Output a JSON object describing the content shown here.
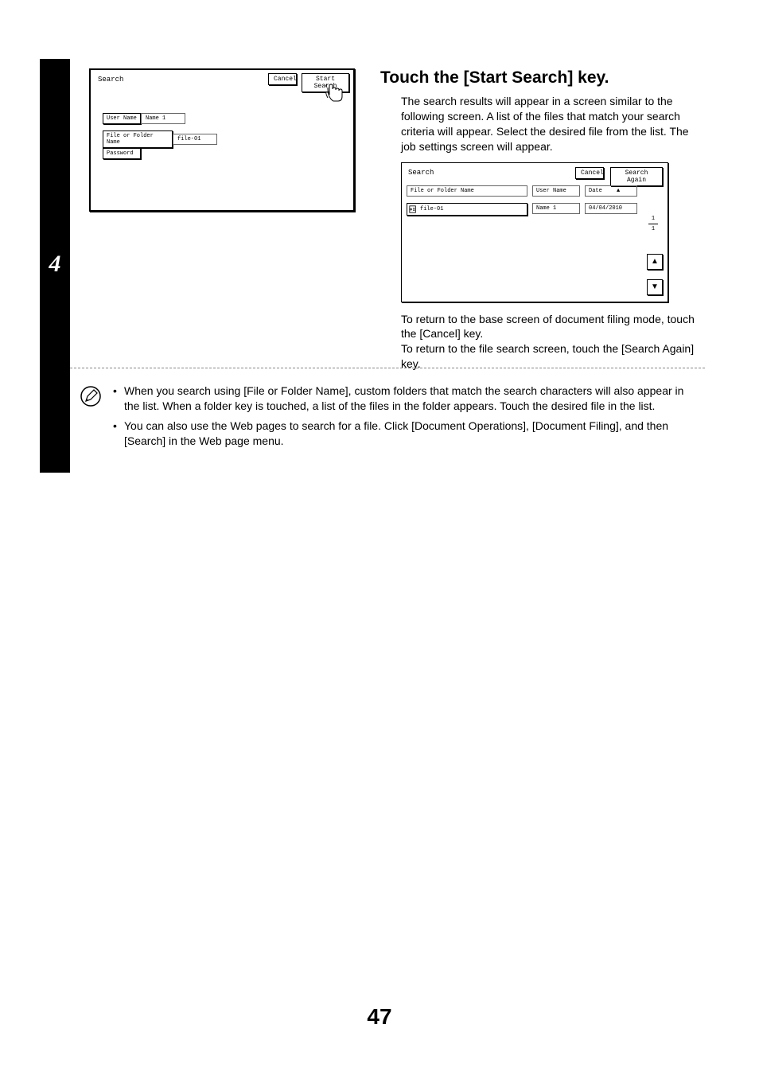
{
  "step_number": "4",
  "left_panel": {
    "title": "Search",
    "cancel_label": "Cancel",
    "start_label": "Start Search",
    "username_label": "User Name",
    "username_value": "Name 1",
    "filefolder_label": "File or Folder Name",
    "filefolder_value": "file-01",
    "password_label": "Password"
  },
  "right": {
    "heading": "Touch the [Start Search] key.",
    "intro": "The search results will appear in a screen similar to the following screen. A list of the files that match your search criteria will appear. Select the desired file from the list. The job settings screen will appear.",
    "results_panel": {
      "title": "Search",
      "cancel_label": "Cancel",
      "again_label": "Search Again",
      "hdr_file": "File or Folder Name",
      "hdr_user": "User Name",
      "hdr_date": "Date",
      "row_file": "file-01",
      "row_user": "Name 1",
      "row_date": "04/04/2010",
      "page_cur": "1",
      "page_tot": "1"
    },
    "after1": "To return to the base screen of document filing mode, touch the [Cancel] key.",
    "after2": "To return to the file search screen, touch the [Search Again] key."
  },
  "notes": {
    "n1": "When you search using [File or Folder Name], custom folders that match the search characters will also appear in the list. When a folder key is touched, a list of the files in the folder appears. Touch the desired file in the list.",
    "n2": "You can also use the Web pages to search for a file. Click [Document Operations], [Document Filing], and then [Search] in the Web page menu."
  },
  "page_number": "47"
}
